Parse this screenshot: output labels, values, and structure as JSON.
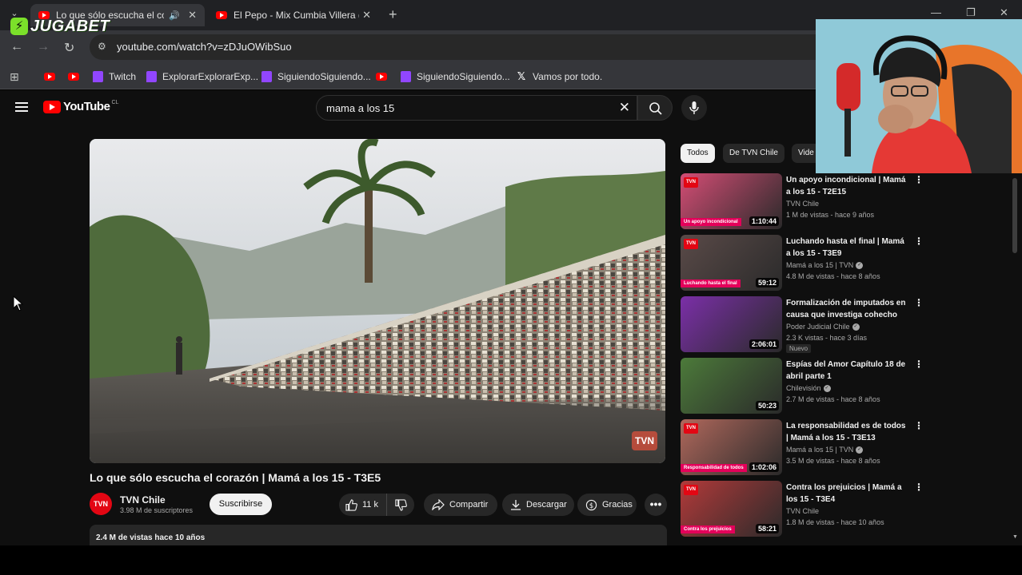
{
  "browser": {
    "tabs": [
      {
        "title": "Lo que sólo escucha el corazón",
        "active": true
      },
      {
        "title": "El Pepo - Mix Cumbia Villera (Éx",
        "active": false
      }
    ],
    "url": "youtube.com/watch?v=zDJuOWibSuo",
    "bookmarks": [
      {
        "label": "",
        "icon": "youtube-icon"
      },
      {
        "label": "",
        "icon": "youtube-icon"
      },
      {
        "label": "Twitch",
        "icon": "twitch-icon"
      },
      {
        "label": "ExplorarExplorarExp...",
        "icon": "twitch-icon"
      },
      {
        "label": "SiguiendoSiguiendo...",
        "icon": "twitch-icon"
      },
      {
        "label": "",
        "icon": "youtube-icon"
      },
      {
        "label": "SiguiendoSiguiendo...",
        "icon": "twitch-icon"
      },
      {
        "label": "Vamos por todo.",
        "icon": "x-icon"
      }
    ]
  },
  "overlay": {
    "sponsor": "JUGABET"
  },
  "youtube": {
    "logo_text": "YouTube",
    "country": "CL",
    "search_query": "mama a los 15",
    "video": {
      "title": "Lo que sólo escucha el corazón | Mamá a los 15 - T3E5",
      "watermark": "TVN",
      "channel": "TVN Chile",
      "channel_avatar": "TVN",
      "subscribers": "3.98 M de suscriptores",
      "subscribe_label": "Suscribirse",
      "likes": "11 k",
      "share_label": "Compartir",
      "download_label": "Descargar",
      "thanks_label": "Gracias",
      "more_label": "•••",
      "views_date": "2.4 M de vistas  hace 10 años"
    },
    "chips": [
      "Todos",
      "De TVN Chile",
      "Vide"
    ],
    "related": [
      {
        "title": "Un apoyo incondicional | Mamá a los 15 - T2E15",
        "channel": "TVN Chile",
        "verified": false,
        "stats": "1 M de vistas - hace 9 años",
        "duration": "1:10:44",
        "badge": "",
        "thumb_caption": "Un apoyo incondicional",
        "thumb_color": "#d44d75"
      },
      {
        "title": "Luchando hasta el final | Mamá a los 15 - T3E9",
        "channel": "Mamá a los 15 | TVN",
        "verified": true,
        "stats": "4.8 M de vistas - hace 8 años",
        "duration": "59:12",
        "badge": "",
        "thumb_caption": "Luchando hasta el final",
        "thumb_color": "#5a4a48"
      },
      {
        "title": "Formalización de imputados en causa que investiga cohecho y...",
        "channel": "Poder Judicial Chile",
        "verified": true,
        "stats": "2.3 K vistas - hace 3 días",
        "duration": "2:06:01",
        "badge": "Nuevo",
        "thumb_caption": "",
        "thumb_color": "#7b2fa8"
      },
      {
        "title": "Espías del Amor  Capítulo 18 de abril parte 1",
        "channel": "Chilevisión",
        "verified": true,
        "stats": "2.7 M de vistas - hace 8 años",
        "duration": "50:23",
        "badge": "",
        "thumb_caption": "",
        "thumb_color": "#4c7a3a"
      },
      {
        "title": "La responsabilidad es de todos | Mamá a los 15 - T3E13",
        "channel": "Mamá a los 15 | TVN",
        "verified": true,
        "stats": "3.5 M de vistas - hace 8 años",
        "duration": "1:02:06",
        "badge": "",
        "thumb_caption": "Responsabilidad de todos",
        "thumb_color": "#b0685c"
      },
      {
        "title": "Contra los prejuicios | Mamá a los 15 - T3E4",
        "channel": "TVN Chile",
        "verified": false,
        "stats": "1.8 M de vistas - hace 10 años",
        "duration": "58:21",
        "badge": "",
        "thumb_caption": "Contra los prejuicios",
        "thumb_color": "#b23a3a"
      }
    ]
  }
}
